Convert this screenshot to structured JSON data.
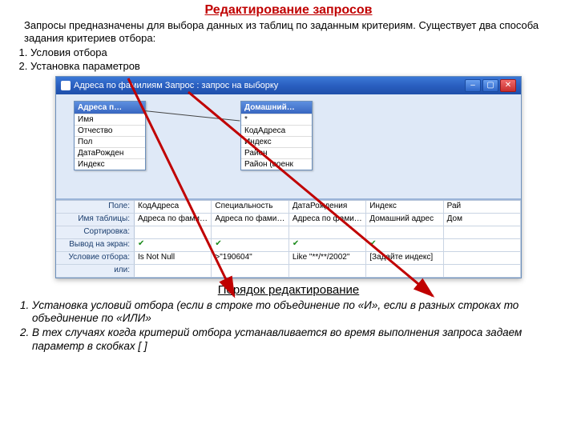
{
  "title": "Редактирование запросов",
  "intro": "Запросы предназначены для выбора данных из таблиц по заданным критериям. Существует два способа задания критериев отбора:",
  "toplist": [
    "Условия отбора",
    "Установка параметров"
  ],
  "window": {
    "caption": "Адреса по фамилиям Запрос : запрос на выборку",
    "table1": {
      "title": "Адреса п…",
      "fields": [
        "Имя",
        "Отчество",
        "Пол",
        "ДатаРожден",
        "Индекс"
      ]
    },
    "table2": {
      "title": "Домашний…",
      "fields": [
        "*",
        "КодАдреса",
        "Индекс",
        "Район",
        "Район (военк"
      ]
    }
  },
  "gridLabels": {
    "field": "Поле:",
    "table": "Имя таблицы:",
    "sort": "Сортировка:",
    "show": "Вывод на экран:",
    "cond": "Условие отбора:",
    "or": "или:"
  },
  "cols": [
    {
      "field": "КодАдреса",
      "table": "Адреса по фамили",
      "cond": "Is Not Null"
    },
    {
      "field": "Специальность",
      "table": "Адреса по фамили",
      "cond": ">\"190604\""
    },
    {
      "field": "ДатаРождения",
      "table": "Адреса по фамили",
      "cond": "Like \"**/**/2002\""
    },
    {
      "field": "Индекс",
      "table": "Домашний адрес",
      "cond": "[Задайте индекс]"
    },
    {
      "field": "Рай",
      "table": "Дом",
      "cond": ""
    }
  ],
  "subhead": "Порядок редактирование",
  "botlist": [
    "Установка условий отбора (если в строке то объединение по «И», если в разных строках то объединение по «ИЛИ»",
    "В тех случаях когда критерий отбора устанавливается во время выполнения запроса задаем параметр в скобках [ ]"
  ]
}
